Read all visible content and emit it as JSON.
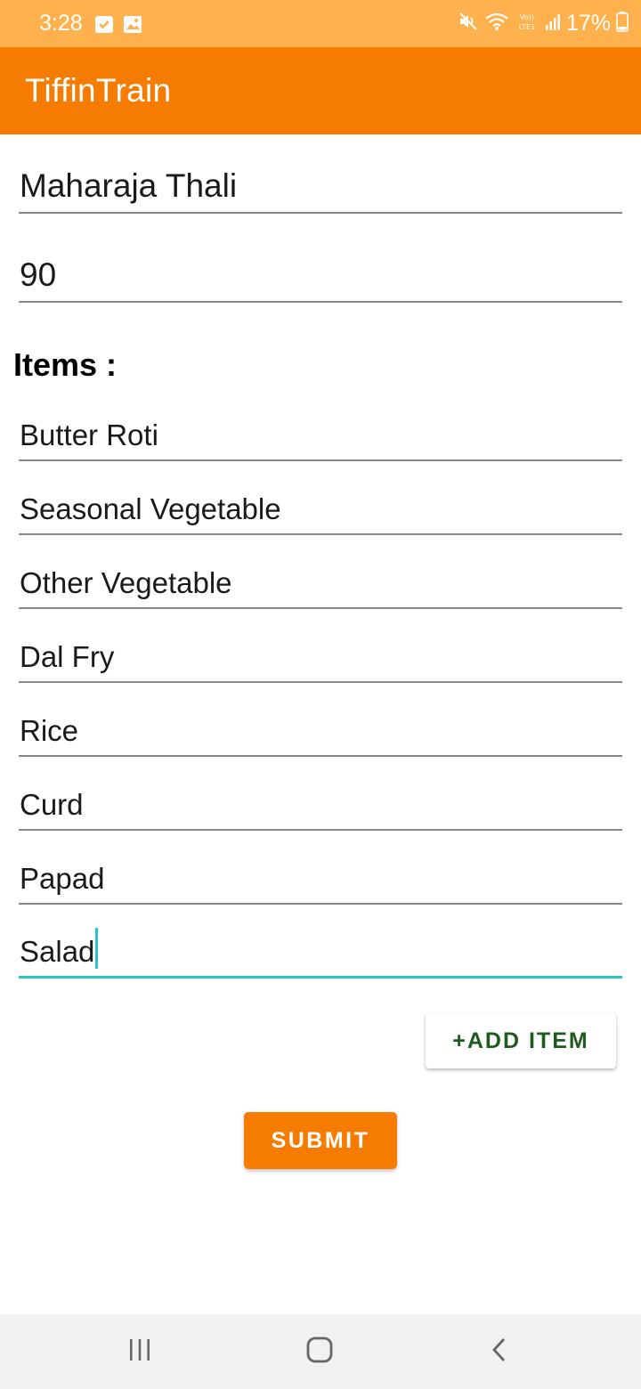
{
  "status_bar": {
    "time": "3:28",
    "battery": "17%",
    "left_icons": [
      "check-notification-icon",
      "image-notification-icon"
    ],
    "right_icons": [
      "mute-icon",
      "wifi-icon",
      "volte-lte-icon",
      "signal-icon",
      "battery-icon"
    ],
    "volte_label": "VoLTE1"
  },
  "app_bar": {
    "title": "TiffinTrain"
  },
  "form": {
    "name_value": "Maharaja Thali",
    "price_value": "90",
    "items_heading": "Items :",
    "items": [
      "Butter Roti",
      "Seasonal Vegetable",
      "Other Vegetable",
      "Dal Fry",
      "Rice",
      "Curd",
      "Papad",
      "Salad"
    ],
    "add_item_label": "+ADD ITEM",
    "submit_label": "SUBMIT"
  },
  "colors": {
    "status_bar": "#FFB14E",
    "app_bar": "#F57C00",
    "accent_focus": "#26C6C6",
    "add_item_text": "#1E5B1E"
  },
  "nav_bar": {
    "icons": [
      "recents-icon",
      "home-icon",
      "back-icon"
    ]
  }
}
